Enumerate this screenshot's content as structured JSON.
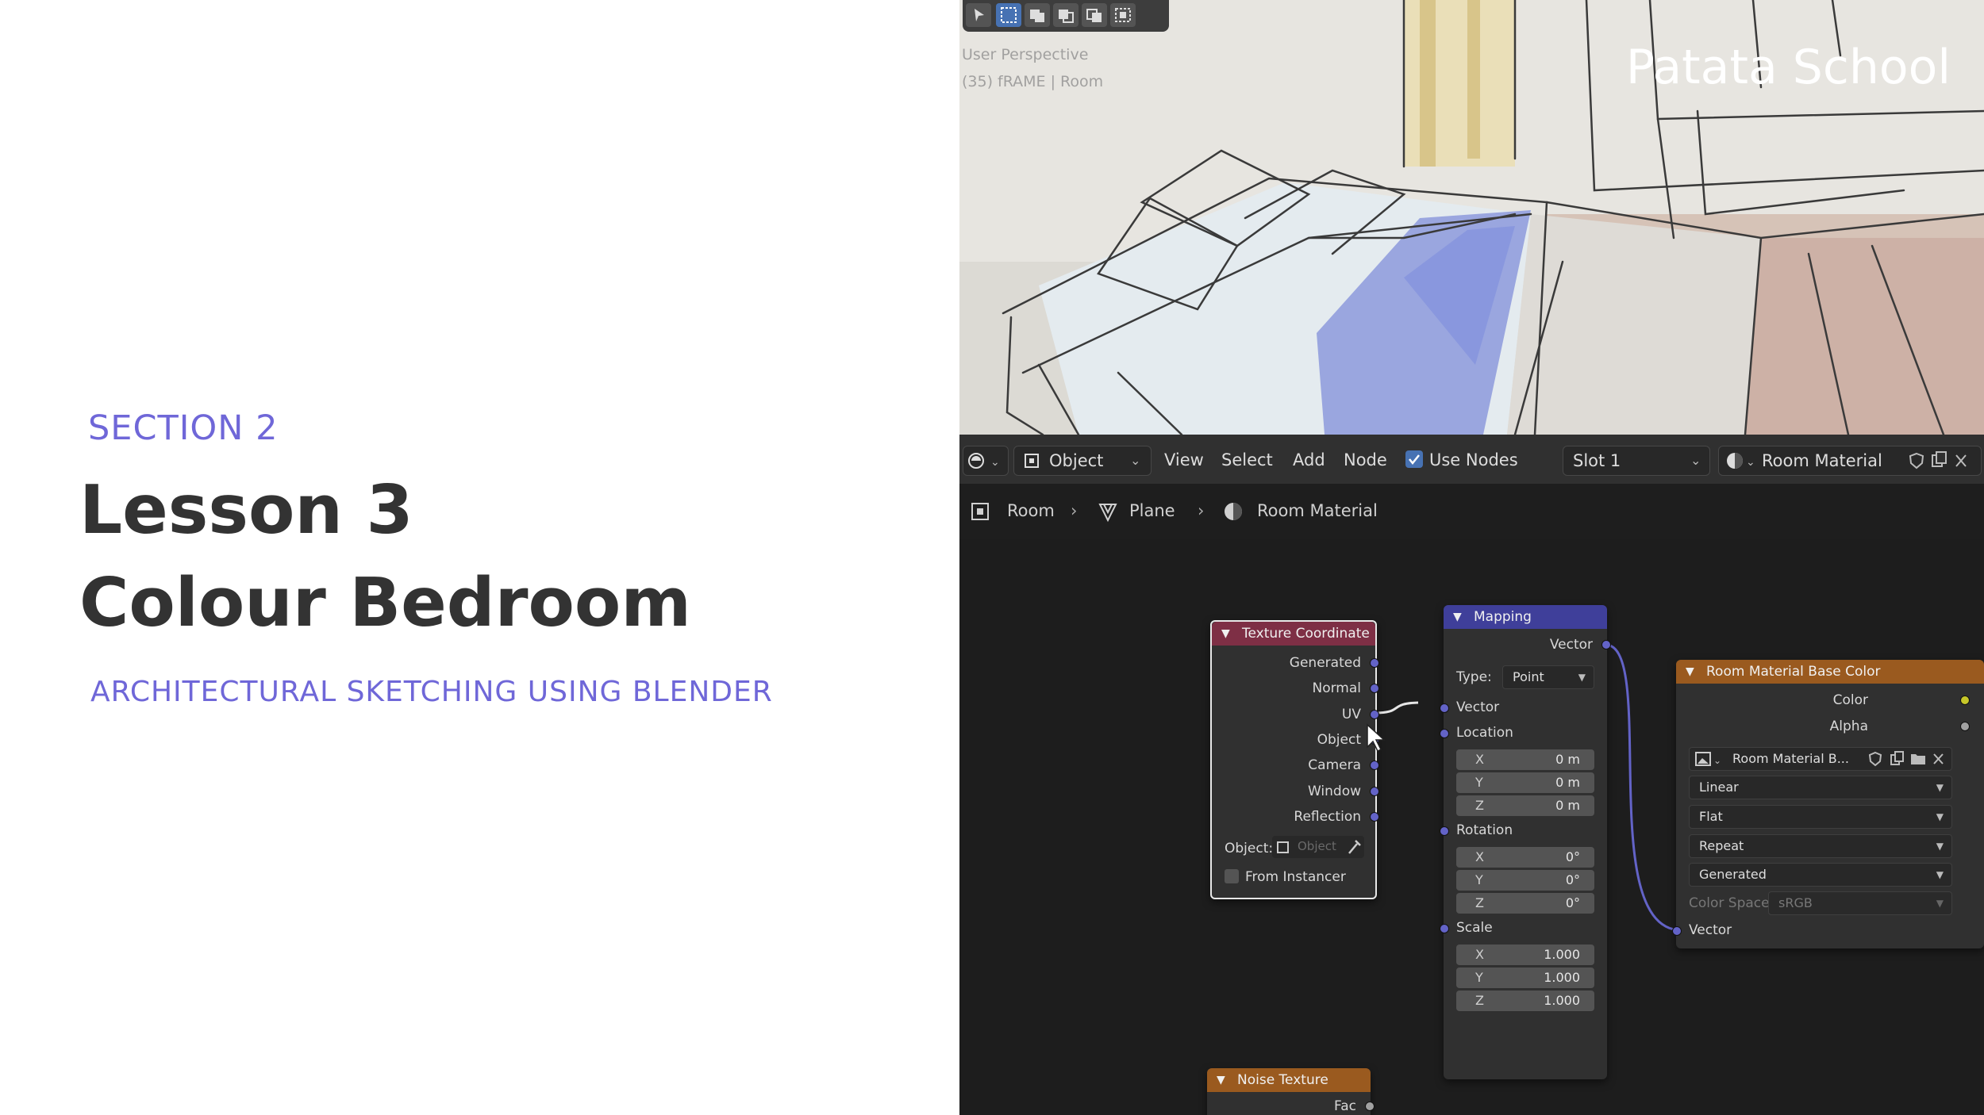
{
  "lesson": {
    "section": "SECTION 2",
    "title_line1": "Lesson 3",
    "title_line2": "Colour Bedroom",
    "subtitle": "ARCHITECTURAL SKETCHING USING BLENDER"
  },
  "viewport": {
    "info_line1": "User Perspective",
    "info_line2": "(35) fRAME | Room",
    "watermark": "Patata School"
  },
  "header": {
    "mode": "Object",
    "menus": [
      "View",
      "Select",
      "Add",
      "Node"
    ],
    "use_nodes_label": "Use Nodes",
    "use_nodes_checked": true,
    "slot": "Slot 1",
    "material_name": "Room Material"
  },
  "breadcrumb": {
    "object": "Room",
    "mesh": "Plane",
    "material": "Room Material"
  },
  "nodes": {
    "texture_coordinate": {
      "title": "Texture Coordinate",
      "outputs": [
        "Generated",
        "Normal",
        "UV",
        "Object",
        "Camera",
        "Window",
        "Reflection"
      ],
      "object_label": "Object:",
      "object_placeholder": "Object",
      "from_instancer_label": "From Instancer"
    },
    "mapping": {
      "title": "Mapping",
      "output_vector": "Vector",
      "type_label": "Type:",
      "type_value": "Point",
      "input_vector": "Vector",
      "location_label": "Location",
      "location": [
        {
          "axis": "X",
          "value": "0 m"
        },
        {
          "axis": "Y",
          "value": "0 m"
        },
        {
          "axis": "Z",
          "value": "0 m"
        }
      ],
      "rotation_label": "Rotation",
      "rotation": [
        {
          "axis": "X",
          "value": "0°"
        },
        {
          "axis": "Y",
          "value": "0°"
        },
        {
          "axis": "Z",
          "value": "0°"
        }
      ],
      "scale_label": "Scale",
      "scale": [
        {
          "axis": "X",
          "value": "1.000"
        },
        {
          "axis": "Y",
          "value": "1.000"
        },
        {
          "axis": "Z",
          "value": "1.000"
        }
      ]
    },
    "image_texture": {
      "title": "Room Material Base Color",
      "outputs": [
        "Color",
        "Alpha"
      ],
      "image_name": "Room Material B...",
      "interpolation": "Linear",
      "projection": "Flat",
      "extension": "Repeat",
      "source": "Generated",
      "color_space_label": "Color Space",
      "color_space_value": "sRGB",
      "input_vector": "Vector"
    },
    "noise_texture": {
      "title": "Noise Texture",
      "output_fac": "Fac"
    }
  },
  "colors": {
    "accent": "#6f67d8",
    "title_text": "#333333",
    "tex_coord_header": "#7e2f45",
    "mapping_header": "#3f3f9a",
    "texture_header": "#9a5a1f",
    "vector_socket": "#6363c7",
    "color_socket": "#c7c729"
  }
}
